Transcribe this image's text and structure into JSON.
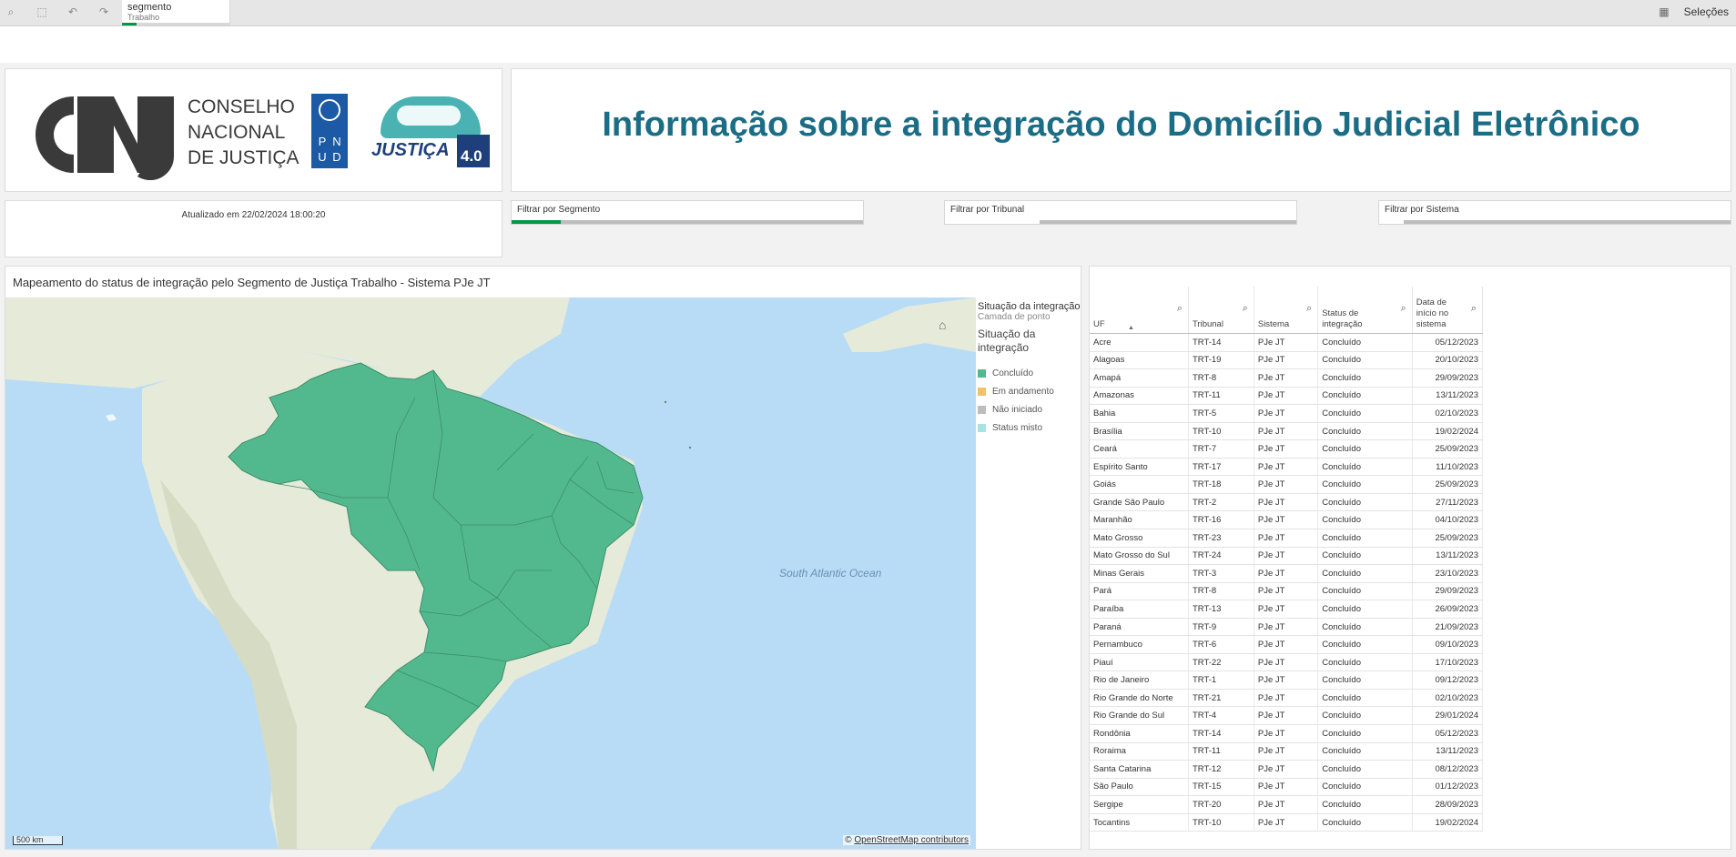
{
  "toolbar": {
    "icons": [
      "smart-search-icon",
      "lasso-select-icon",
      "step-back-icon",
      "step-forward-icon",
      "clear-selections-icon"
    ]
  },
  "selection_chip": {
    "field": "segmento",
    "value": "Trabalho"
  },
  "selections_label": "Seleções",
  "header": {
    "cnj_lines": [
      "CONSELHO",
      "NACIONAL",
      "DE JUSTIÇA"
    ],
    "logo_cnj": "CNJ",
    "logo_pnud": "PNUD",
    "logo_justica": "JUSTIÇA",
    "logo_justica_version": "4.0",
    "title": "Informação sobre a integração do Domicílio Judicial Eletrônico"
  },
  "updated": "Atualizado em 22/02/2024 18:00:20",
  "filters": [
    {
      "label": "Filtrar por Segmento",
      "selected_fraction": 0.14,
      "color": "#009845"
    },
    {
      "label": "Filtrar por Tribunal",
      "selected_fraction": 0.27,
      "color": "#ffffff"
    },
    {
      "label": "Filtrar por Sistema",
      "selected_fraction": 0.07,
      "color": "#ffffff"
    }
  ],
  "map": {
    "title": "Mapeamento do status de integração pelo Segmento de Justiça Trabalho - Sistema PJe JT",
    "ocean_label": "South Atlantic Ocean",
    "scale_label": "500 km",
    "attribution_prefix": "©",
    "attribution_link": "OpenStreetMap contributors",
    "legend": {
      "title": "Situação da integração",
      "layer": "Camada de ponto",
      "dimension": "Situação da integração",
      "items": [
        {
          "label": "Concluído",
          "color": "#52b98e"
        },
        {
          "label": "Em andamento",
          "color": "#f2c26b"
        },
        {
          "label": "Não iniciado",
          "color": "#bdbdbd"
        },
        {
          "label": "Status misto",
          "color": "#a6e4e4"
        }
      ]
    }
  },
  "table": {
    "columns": [
      "UF",
      "Tribunal",
      "Sistema",
      "Status de integração",
      "Data de início no sistema"
    ],
    "rows": [
      [
        "Acre",
        "TRT-14",
        "PJe JT",
        "Concluído",
        "05/12/2023"
      ],
      [
        "Alagoas",
        "TRT-19",
        "PJe JT",
        "Concluído",
        "20/10/2023"
      ],
      [
        "Amapá",
        "TRT-8",
        "PJe JT",
        "Concluído",
        "29/09/2023"
      ],
      [
        "Amazonas",
        "TRT-11",
        "PJe JT",
        "Concluído",
        "13/11/2023"
      ],
      [
        "Bahia",
        "TRT-5",
        "PJe JT",
        "Concluído",
        "02/10/2023"
      ],
      [
        "Brasília",
        "TRT-10",
        "PJe JT",
        "Concluído",
        "19/02/2024"
      ],
      [
        "Ceará",
        "TRT-7",
        "PJe JT",
        "Concluído",
        "25/09/2023"
      ],
      [
        "Espírito Santo",
        "TRT-17",
        "PJe JT",
        "Concluído",
        "11/10/2023"
      ],
      [
        "Goiás",
        "TRT-18",
        "PJe JT",
        "Concluído",
        "25/09/2023"
      ],
      [
        "Grande São Paulo",
        "TRT-2",
        "PJe JT",
        "Concluído",
        "27/11/2023"
      ],
      [
        "Maranhão",
        "TRT-16",
        "PJe JT",
        "Concluído",
        "04/10/2023"
      ],
      [
        "Mato Grosso",
        "TRT-23",
        "PJe JT",
        "Concluído",
        "25/09/2023"
      ],
      [
        "Mato Grosso do Sul",
        "TRT-24",
        "PJe JT",
        "Concluído",
        "13/11/2023"
      ],
      [
        "Minas Gerais",
        "TRT-3",
        "PJe JT",
        "Concluído",
        "23/10/2023"
      ],
      [
        "Pará",
        "TRT-8",
        "PJe JT",
        "Concluído",
        "29/09/2023"
      ],
      [
        "Paraíba",
        "TRT-13",
        "PJe JT",
        "Concluído",
        "26/09/2023"
      ],
      [
        "Paraná",
        "TRT-9",
        "PJe JT",
        "Concluído",
        "21/09/2023"
      ],
      [
        "Pernambuco",
        "TRT-6",
        "PJe JT",
        "Concluído",
        "09/10/2023"
      ],
      [
        "Piauí",
        "TRT-22",
        "PJe JT",
        "Concluído",
        "17/10/2023"
      ],
      [
        "Rio de Janeiro",
        "TRT-1",
        "PJe JT",
        "Concluído",
        "09/12/2023"
      ],
      [
        "Rio Grande do Norte",
        "TRT-21",
        "PJe JT",
        "Concluído",
        "02/10/2023"
      ],
      [
        "Rio Grande do Sul",
        "TRT-4",
        "PJe JT",
        "Concluído",
        "29/01/2024"
      ],
      [
        "Rondônia",
        "TRT-14",
        "PJe JT",
        "Concluído",
        "05/12/2023"
      ],
      [
        "Roraima",
        "TRT-11",
        "PJe JT",
        "Concluído",
        "13/11/2023"
      ],
      [
        "Santa Catarina",
        "TRT-12",
        "PJe JT",
        "Concluído",
        "08/12/2023"
      ],
      [
        "São Paulo",
        "TRT-15",
        "PJe JT",
        "Concluído",
        "01/12/2023"
      ],
      [
        "Sergipe",
        "TRT-20",
        "PJe JT",
        "Concluído",
        "28/09/2023"
      ],
      [
        "Tocantins",
        "TRT-10",
        "PJe JT",
        "Concluído",
        "19/02/2024"
      ]
    ]
  }
}
